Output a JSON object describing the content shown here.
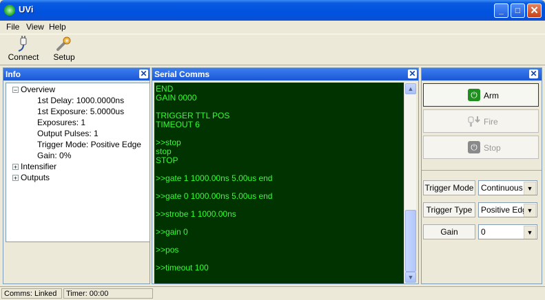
{
  "window": {
    "title": "UVi",
    "minimize_label": "_",
    "maximize_label": "□",
    "close_label": "✕"
  },
  "menu": {
    "items": [
      "File",
      "View",
      "Help"
    ]
  },
  "toolbar": {
    "connect_label": "Connect",
    "setup_label": "Setup"
  },
  "info_panel": {
    "title": "Info",
    "close_label": "✕",
    "tree": [
      {
        "label": "Overview",
        "sign": "−"
      },
      {
        "label": "1st Delay: 1000.0000ns"
      },
      {
        "label": "1st Exposure: 5.0000us"
      },
      {
        "label": "Exposures: 1"
      },
      {
        "label": "Output Pulses: 1"
      },
      {
        "label": "Trigger Mode: Positive Edge"
      },
      {
        "label": "Gain: 0%"
      },
      {
        "label": "Intensifier",
        "sign": "+"
      },
      {
        "label": "Outputs",
        "sign": "+"
      }
    ]
  },
  "serial_panel": {
    "title": "Serial Comms",
    "close_label": "✕",
    "lines": [
      "END",
      "GAIN 0000",
      "",
      "TRIGGER TTL POS",
      "TIMEOUT 6",
      "",
      ">>stop",
      "stop",
      "STOP",
      "",
      ">>gate 1 1000.00ns 5.00us end",
      "",
      ">>gate 0 1000.00ns 5.00us end",
      "",
      ">>strobe 1 1000.00ns",
      "",
      ">>gain 0",
      "",
      ">>pos",
      "",
      ">>timeout 100"
    ],
    "scroll_up": "▲",
    "scroll_down": "▼"
  },
  "control_panel": {
    "close_label": "✕",
    "arm_label": "Arm",
    "fire_label": "Fire",
    "stop_label": "Stop",
    "power_glyph": "⏻",
    "trigger_mode_label": "Trigger Mode",
    "trigger_mode_value": "Continuous",
    "trigger_type_label": "Trigger Type",
    "trigger_type_value": "Positive Edge",
    "gain_label": "Gain",
    "gain_value": "0",
    "dropdown_glyph": "▼",
    "accent_arm": "#1f8f1f"
  },
  "status": {
    "comms": "Comms: Linked",
    "timer": "Timer: 00:00"
  }
}
